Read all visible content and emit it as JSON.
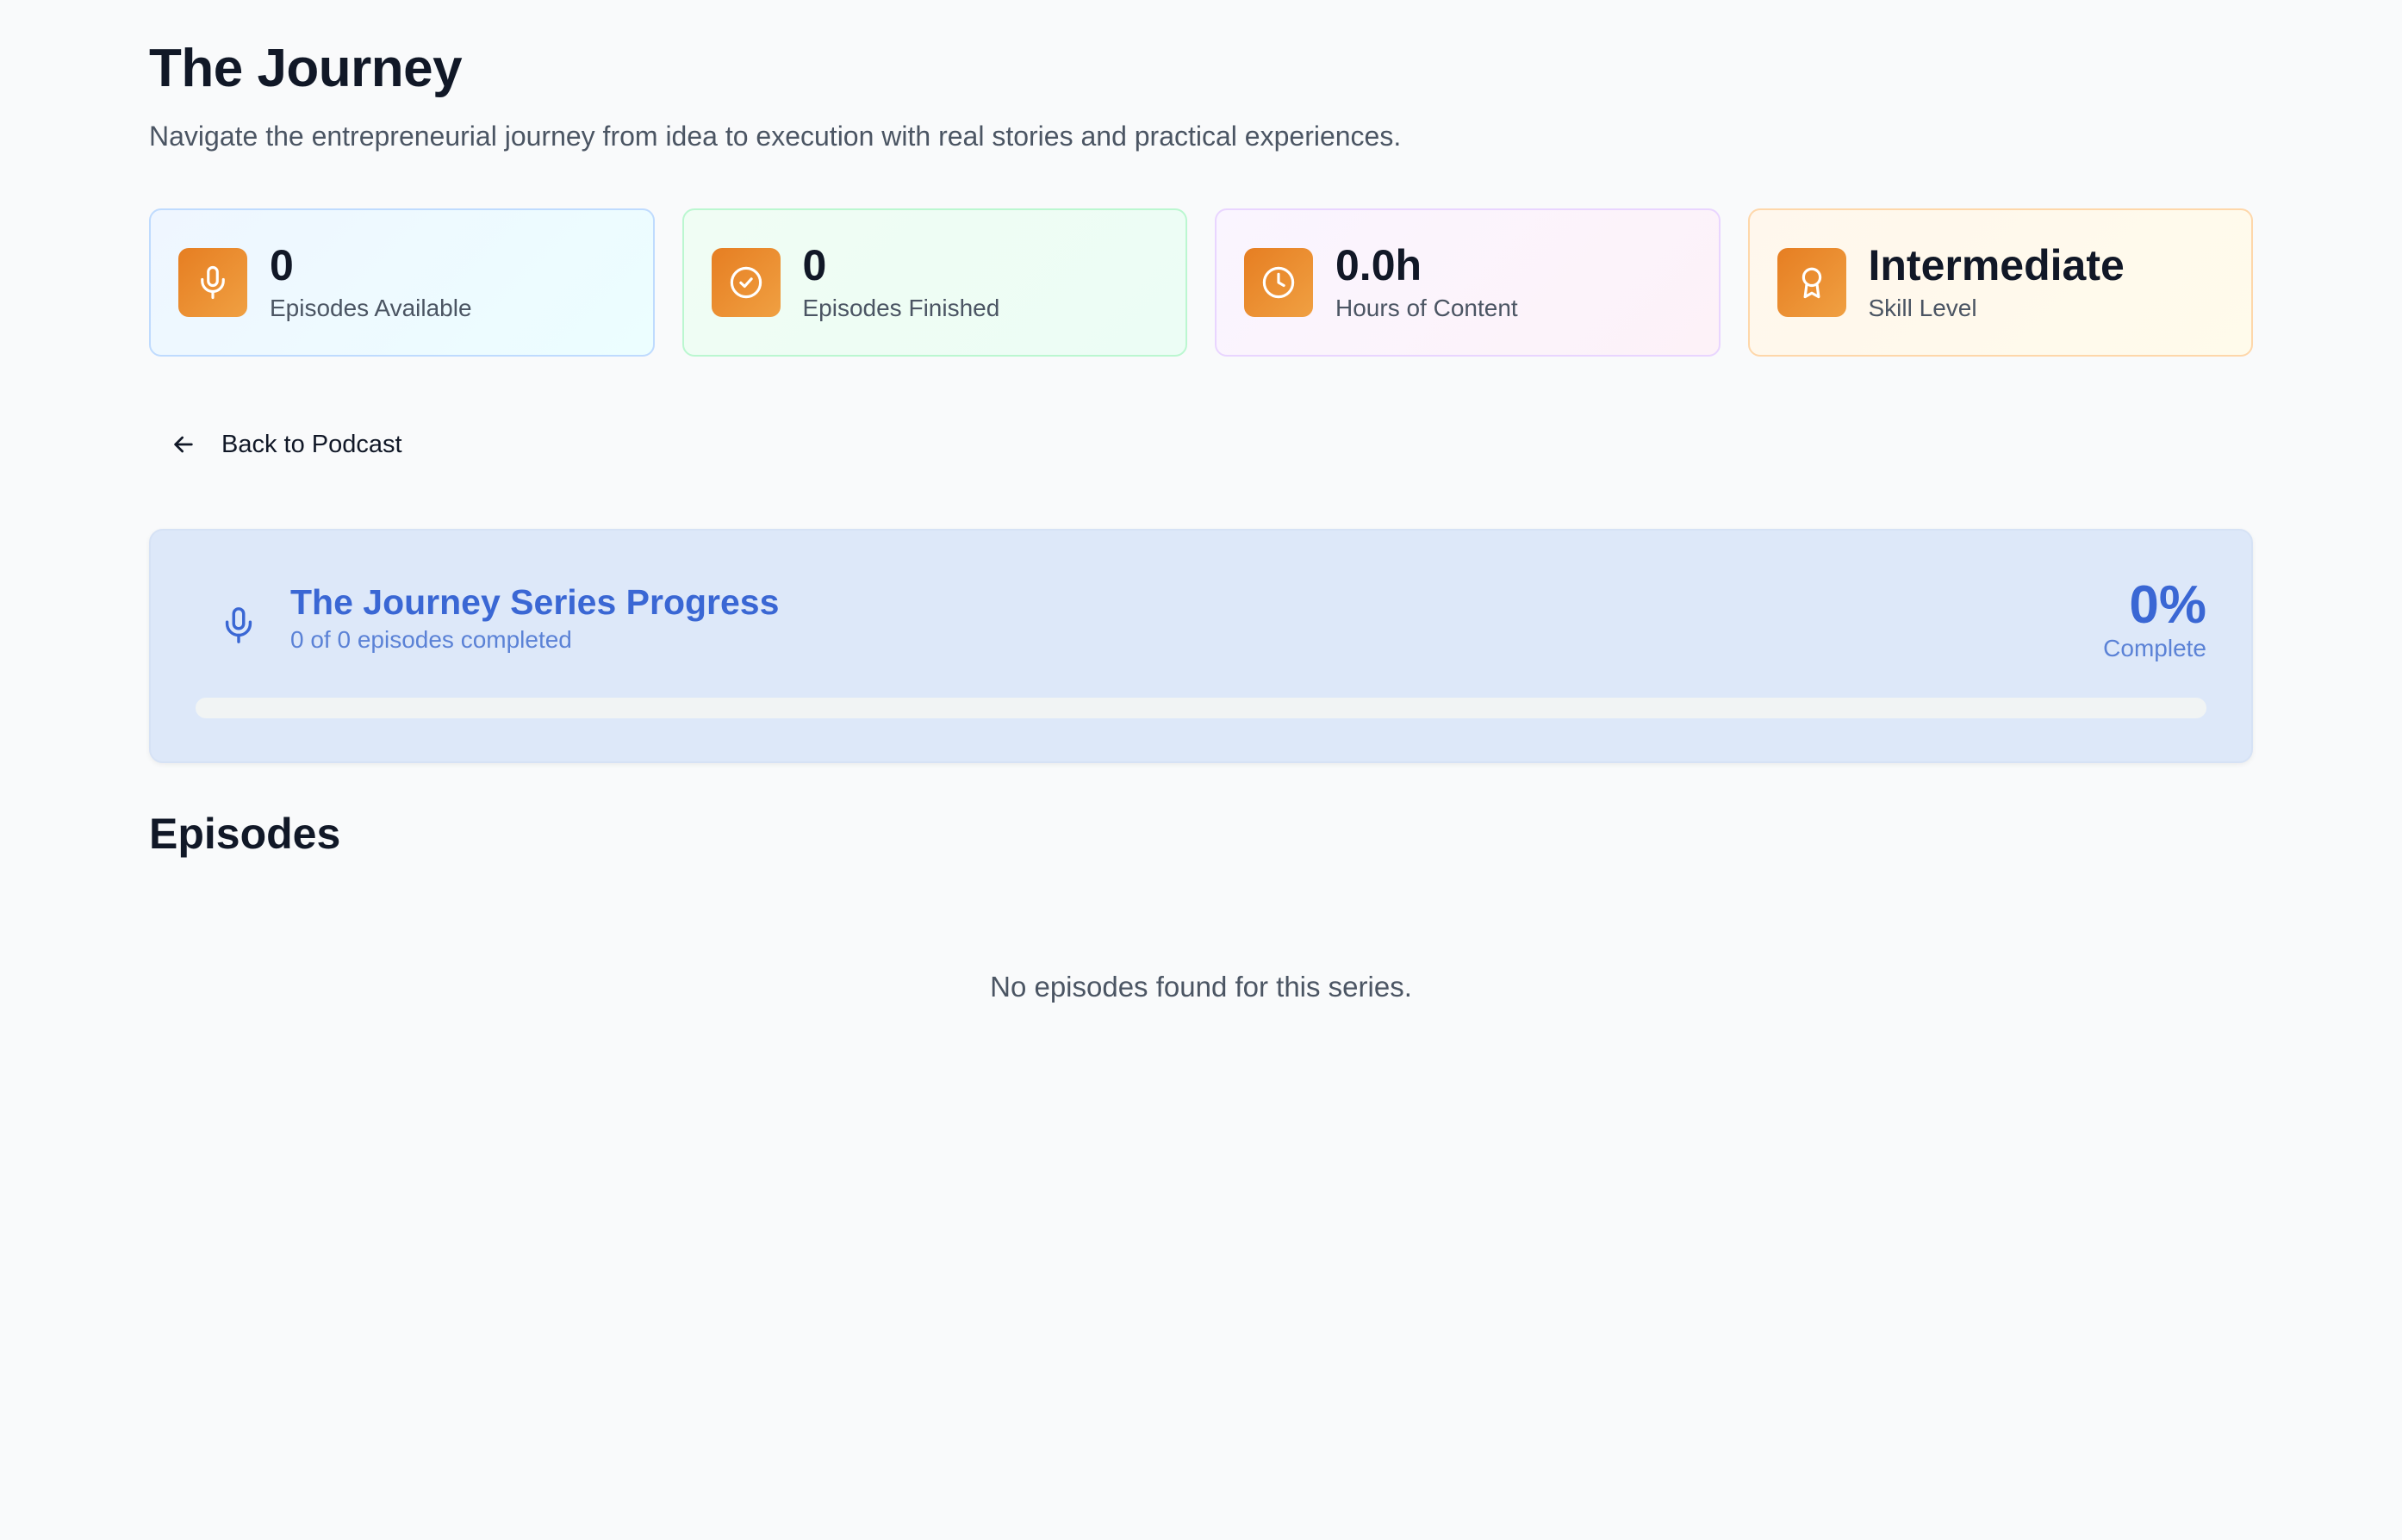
{
  "header": {
    "title": "The Journey",
    "subtitle": "Navigate the entrepreneurial journey from idea to execution with real stories and practical experiences."
  },
  "stats": [
    {
      "value": "0",
      "label": "Episodes Available",
      "icon": "microphone-icon"
    },
    {
      "value": "0",
      "label": "Episodes Finished",
      "icon": "check-circle-icon"
    },
    {
      "value": "0.0h",
      "label": "Hours of Content",
      "icon": "clock-icon"
    },
    {
      "value": "Intermediate",
      "label": "Skill Level",
      "icon": "award-icon"
    }
  ],
  "nav": {
    "back_label": "Back to Podcast"
  },
  "progress": {
    "title": "The Journey Series Progress",
    "subtitle": "0 of 0 episodes completed",
    "percent_text": "0%",
    "percent_label": "Complete",
    "fraction": 0
  },
  "episodes": {
    "heading": "Episodes",
    "empty_message": "No episodes found for this series."
  },
  "colors": {
    "accent": "#3a67d4",
    "icon_gradient_start": "#e67e22",
    "icon_gradient_end": "#f0a042",
    "progress_bg": "#dde8f9"
  }
}
